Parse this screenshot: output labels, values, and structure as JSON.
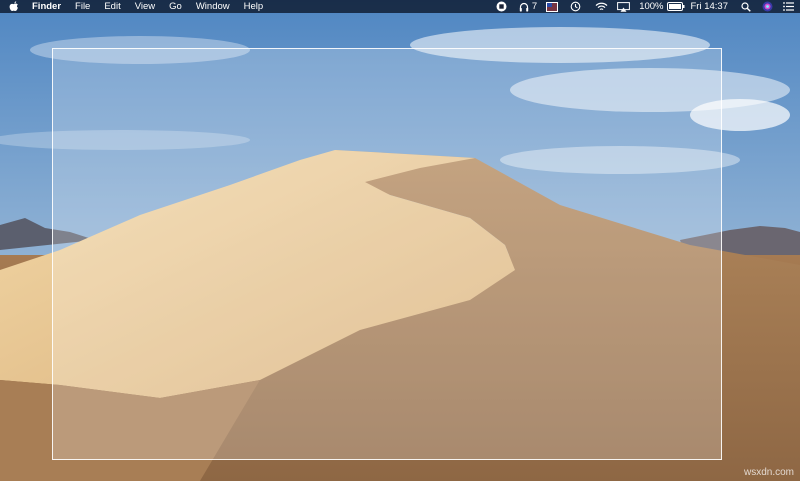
{
  "menubar": {
    "app_name": "Finder",
    "menus": [
      "File",
      "Edit",
      "View",
      "Go",
      "Window",
      "Help"
    ],
    "status": {
      "notification_count": "7",
      "battery_percent": "100%",
      "clock": "Fri 14:37"
    }
  },
  "icons": {
    "apple": "apple-logo",
    "record": "record-icon",
    "headphones": "headphones-icon",
    "flag": "flag-icon",
    "time_machine": "time-machine-icon",
    "wifi": "wifi-icon",
    "airplay": "airplay-icon",
    "battery": "battery-icon",
    "search": "spotlight-search-icon",
    "siri": "siri-icon",
    "notification_center": "notification-center-icon"
  },
  "watermark": "wsxdn.com",
  "colors": {
    "menubar": "#0a1428",
    "sky": "#6f9fd0",
    "sand": "#c9a171"
  }
}
